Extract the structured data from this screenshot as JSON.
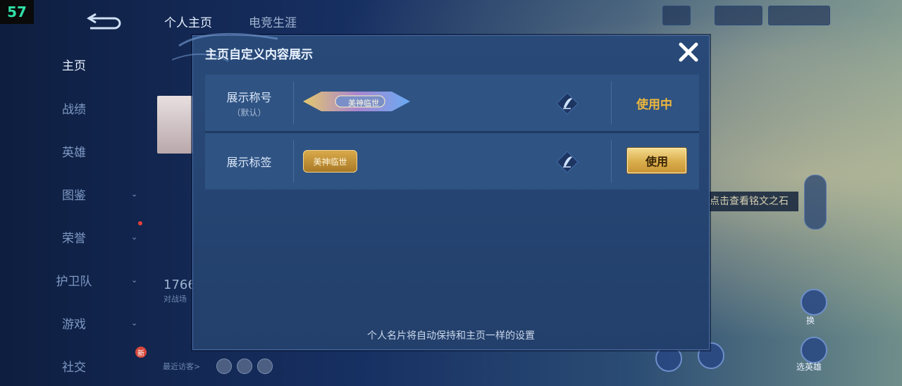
{
  "fps": "57",
  "top_tabs": [
    "个人主页",
    "电竞生涯"
  ],
  "sidebar": {
    "items": [
      {
        "label": "主页",
        "active": true
      },
      {
        "label": "战绩"
      },
      {
        "label": "英雄"
      },
      {
        "label": "图鉴",
        "chevron": true
      },
      {
        "label": "荣誉",
        "chevron": true,
        "dot": true
      },
      {
        "label": "护卫队",
        "chevron": true
      },
      {
        "label": "游戏",
        "chevron": true
      },
      {
        "label": "社交",
        "badge": "新"
      }
    ]
  },
  "background": {
    "count_number": "1766",
    "count_sub": "对战场",
    "visitors_label": "最近访客>",
    "hint_text": "点击查看铭文之石",
    "right_labels": [
      "换",
      "选英雄"
    ]
  },
  "modal": {
    "title": "主页自定义内容展示",
    "rows": [
      {
        "label": "展示称号",
        "sub": "（默认）",
        "badge_text": "美神临世",
        "status": "使用中"
      },
      {
        "label": "展示标签",
        "badge_text": "美神临世",
        "button": "使用"
      }
    ],
    "footer": "个人名片将自动保持和主页一样的设置"
  },
  "colors": {
    "accent_gold": "#f0b83c",
    "modal_bg": "#294a78"
  }
}
